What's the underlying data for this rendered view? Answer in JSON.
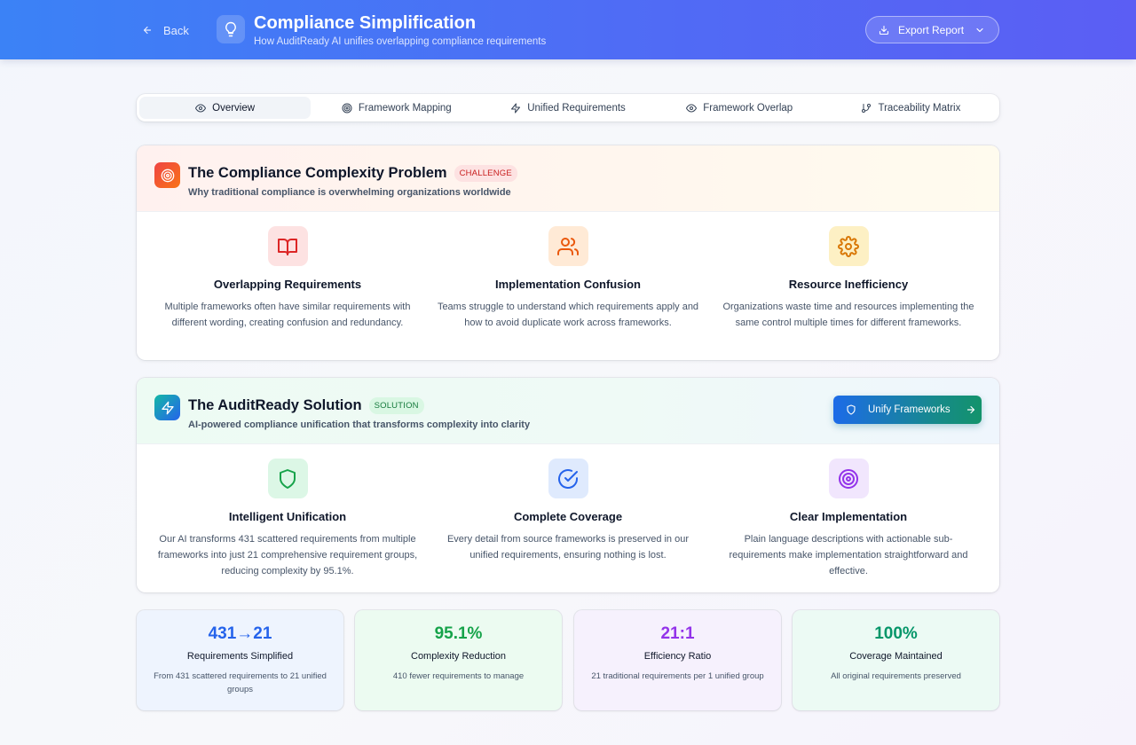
{
  "header": {
    "back_label": "Back",
    "title": "Compliance Simplification",
    "subtitle": "How AuditReady AI unifies overlapping compliance requirements",
    "export_label": "Export Report"
  },
  "tabs": [
    {
      "label": "Overview",
      "icon": "eye-icon",
      "active": true
    },
    {
      "label": "Framework Mapping",
      "icon": "target-icon",
      "active": false
    },
    {
      "label": "Unified Requirements",
      "icon": "zap-icon",
      "active": false
    },
    {
      "label": "Framework Overlap",
      "icon": "eye-icon",
      "active": false
    },
    {
      "label": "Traceability Matrix",
      "icon": "git-branch-icon",
      "active": false
    }
  ],
  "problem": {
    "title": "The Compliance Complexity Problem",
    "badge": "CHALLENGE",
    "subtitle": "Why traditional compliance is overwhelming organizations worldwide",
    "features": [
      {
        "icon": "book-icon",
        "title": "Overlapping Requirements",
        "description": "Multiple frameworks often have similar requirements with different wording, creating confusion and redundancy."
      },
      {
        "icon": "users-icon",
        "title": "Implementation Confusion",
        "description": "Teams struggle to understand which requirements apply and how to avoid duplicate work across frameworks."
      },
      {
        "icon": "gear-icon",
        "title": "Resource Inefficiency",
        "description": "Organizations waste time and resources implementing the same control multiple times for different frameworks."
      }
    ]
  },
  "solution": {
    "title": "The AuditReady Solution",
    "badge": "SOLUTION",
    "subtitle": "AI-powered compliance unification that transforms complexity into clarity",
    "button_label": "Unify Frameworks",
    "features": [
      {
        "icon": "shield-icon",
        "title": "Intelligent Unification",
        "description": "Our AI transforms 431 scattered requirements from multiple frameworks into just 21 comprehensive requirement groups, reducing complexity by 95.1%."
      },
      {
        "icon": "check-circle-icon",
        "title": "Complete Coverage",
        "description": "Every detail from source frameworks is preserved in our unified requirements, ensuring nothing is lost."
      },
      {
        "icon": "target-icon",
        "title": "Clear Implementation",
        "description": "Plain language descriptions with actionable sub-requirements make implementation straightforward and effective."
      }
    ]
  },
  "stats": [
    {
      "value": "431→21",
      "label": "Requirements Simplified",
      "description": "From 431 scattered requirements to 21 unified groups",
      "color": "#2563eb"
    },
    {
      "value": "95.1%",
      "label": "Complexity Reduction",
      "description": "410 fewer requirements to manage",
      "color": "#16a34a"
    },
    {
      "value": "21:1",
      "label": "Efficiency Ratio",
      "description": "21 traditional requirements per 1 unified group",
      "color": "#9333ea"
    },
    {
      "value": "100%",
      "label": "Coverage Maintained",
      "description": "All original requirements preserved",
      "color": "#059669"
    }
  ],
  "colors": {
    "header_start": "#3b82f6",
    "header_end": "#5b5ef4",
    "challenge": "#c81e1e",
    "solution": "#157a3c"
  }
}
